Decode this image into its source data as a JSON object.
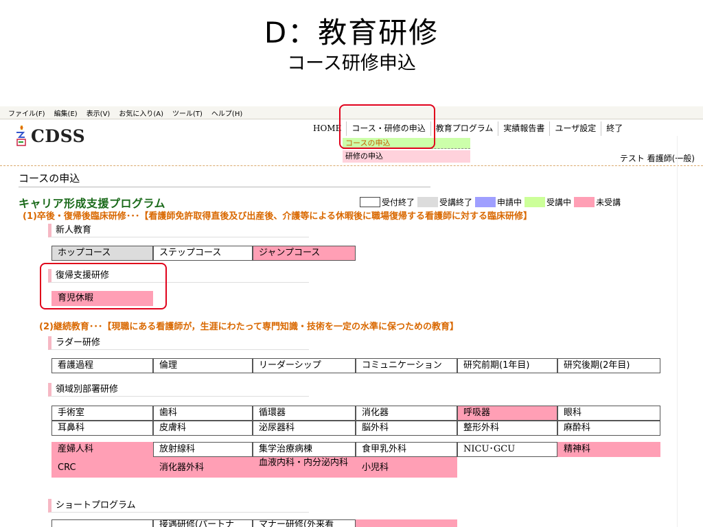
{
  "slide": {
    "title": "D：教育研修",
    "subtitle": "コース研修申込"
  },
  "browser_menu": [
    "ファイル(F)",
    "編集(E)",
    "表示(V)",
    "お気に入り(A)",
    "ツール(T)",
    "ヘルプ(H)"
  ],
  "app": {
    "logo": "CDSS",
    "nav": [
      "HOME",
      "コース・研修の申込",
      "教育プログラム",
      "実績報告書",
      "ユーザ設定",
      "終了"
    ],
    "submenu": {
      "course": "コースの申込",
      "training": "研修の申込"
    },
    "user": "テスト 看護師(一般)"
  },
  "page": {
    "heading": "コースの申込"
  },
  "section": {
    "title": "キャリア形成支援プログラム",
    "legend": [
      "受付終了",
      "受講終了",
      "申請中",
      "受講中",
      "未受講"
    ]
  },
  "legend_colors": {
    "accepting_closed": "#ffffff",
    "completed": "#dcdcdc",
    "applied": "#9f9fff",
    "in_progress": "#ccff99",
    "not_taken": "#ff9fb5"
  },
  "programs": {
    "p1_desc": "(1)卒後・復帰後臨床研修･･･【看護師免許取得直後及び出産後、介護等による休暇後に職場復帰する看護師に対する臨床研修】",
    "new_staff": {
      "label": "新人教育",
      "courses": [
        "ホップコース",
        "ステップコース",
        "ジャンプコース"
      ]
    },
    "return_support": {
      "label": "復帰支援研修",
      "courses": [
        "育児休暇"
      ]
    },
    "p2_desc": "(2)継続教育･･･【現職にある看護師が，生涯にわたって専門知識・技術を一定の水準に保つための教育】",
    "ladder": {
      "label": "ラダー研修",
      "courses": [
        "看護過程",
        "倫理",
        "リーダーシップ",
        "コミュニケーション",
        "研究前期(1年目)",
        "研究後期(2年目)"
      ]
    },
    "departments": {
      "label": "領域別部署研修",
      "rows": [
        [
          "手術室",
          "歯科",
          "循環器",
          "消化器",
          "呼吸器",
          "眼科"
        ],
        [
          "耳鼻科",
          "皮膚科",
          "泌尿器科",
          "脳外科",
          "整形外科",
          "麻酔科"
        ],
        [
          "産婦人科",
          "放射線科",
          "集学治療病棟",
          "食甲乳外科",
          "NICU･GCU",
          "精神科"
        ],
        [
          "CRC",
          "消化器外科",
          "血液内科・内分泌内科",
          "小児科"
        ]
      ]
    },
    "short": {
      "label": "ショートプログラム",
      "courses": [
        "",
        "接遇研修(パートナ",
        "マナー研修(外来看",
        ""
      ]
    }
  }
}
